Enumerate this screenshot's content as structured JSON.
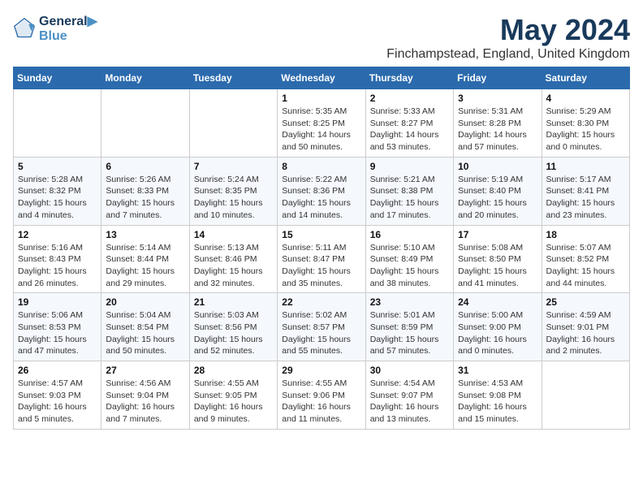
{
  "logo": {
    "line1": "General",
    "line2": "Blue"
  },
  "title": "May 2024",
  "location": "Finchampstead, England, United Kingdom",
  "weekdays": [
    "Sunday",
    "Monday",
    "Tuesday",
    "Wednesday",
    "Thursday",
    "Friday",
    "Saturday"
  ],
  "weeks": [
    [
      {
        "day": "",
        "info": ""
      },
      {
        "day": "",
        "info": ""
      },
      {
        "day": "",
        "info": ""
      },
      {
        "day": "1",
        "info": "Sunrise: 5:35 AM\nSunset: 8:25 PM\nDaylight: 14 hours\nand 50 minutes."
      },
      {
        "day": "2",
        "info": "Sunrise: 5:33 AM\nSunset: 8:27 PM\nDaylight: 14 hours\nand 53 minutes."
      },
      {
        "day": "3",
        "info": "Sunrise: 5:31 AM\nSunset: 8:28 PM\nDaylight: 14 hours\nand 57 minutes."
      },
      {
        "day": "4",
        "info": "Sunrise: 5:29 AM\nSunset: 8:30 PM\nDaylight: 15 hours\nand 0 minutes."
      }
    ],
    [
      {
        "day": "5",
        "info": "Sunrise: 5:28 AM\nSunset: 8:32 PM\nDaylight: 15 hours\nand 4 minutes."
      },
      {
        "day": "6",
        "info": "Sunrise: 5:26 AM\nSunset: 8:33 PM\nDaylight: 15 hours\nand 7 minutes."
      },
      {
        "day": "7",
        "info": "Sunrise: 5:24 AM\nSunset: 8:35 PM\nDaylight: 15 hours\nand 10 minutes."
      },
      {
        "day": "8",
        "info": "Sunrise: 5:22 AM\nSunset: 8:36 PM\nDaylight: 15 hours\nand 14 minutes."
      },
      {
        "day": "9",
        "info": "Sunrise: 5:21 AM\nSunset: 8:38 PM\nDaylight: 15 hours\nand 17 minutes."
      },
      {
        "day": "10",
        "info": "Sunrise: 5:19 AM\nSunset: 8:40 PM\nDaylight: 15 hours\nand 20 minutes."
      },
      {
        "day": "11",
        "info": "Sunrise: 5:17 AM\nSunset: 8:41 PM\nDaylight: 15 hours\nand 23 minutes."
      }
    ],
    [
      {
        "day": "12",
        "info": "Sunrise: 5:16 AM\nSunset: 8:43 PM\nDaylight: 15 hours\nand 26 minutes."
      },
      {
        "day": "13",
        "info": "Sunrise: 5:14 AM\nSunset: 8:44 PM\nDaylight: 15 hours\nand 29 minutes."
      },
      {
        "day": "14",
        "info": "Sunrise: 5:13 AM\nSunset: 8:46 PM\nDaylight: 15 hours\nand 32 minutes."
      },
      {
        "day": "15",
        "info": "Sunrise: 5:11 AM\nSunset: 8:47 PM\nDaylight: 15 hours\nand 35 minutes."
      },
      {
        "day": "16",
        "info": "Sunrise: 5:10 AM\nSunset: 8:49 PM\nDaylight: 15 hours\nand 38 minutes."
      },
      {
        "day": "17",
        "info": "Sunrise: 5:08 AM\nSunset: 8:50 PM\nDaylight: 15 hours\nand 41 minutes."
      },
      {
        "day": "18",
        "info": "Sunrise: 5:07 AM\nSunset: 8:52 PM\nDaylight: 15 hours\nand 44 minutes."
      }
    ],
    [
      {
        "day": "19",
        "info": "Sunrise: 5:06 AM\nSunset: 8:53 PM\nDaylight: 15 hours\nand 47 minutes."
      },
      {
        "day": "20",
        "info": "Sunrise: 5:04 AM\nSunset: 8:54 PM\nDaylight: 15 hours\nand 50 minutes."
      },
      {
        "day": "21",
        "info": "Sunrise: 5:03 AM\nSunset: 8:56 PM\nDaylight: 15 hours\nand 52 minutes."
      },
      {
        "day": "22",
        "info": "Sunrise: 5:02 AM\nSunset: 8:57 PM\nDaylight: 15 hours\nand 55 minutes."
      },
      {
        "day": "23",
        "info": "Sunrise: 5:01 AM\nSunset: 8:59 PM\nDaylight: 15 hours\nand 57 minutes."
      },
      {
        "day": "24",
        "info": "Sunrise: 5:00 AM\nSunset: 9:00 PM\nDaylight: 16 hours\nand 0 minutes."
      },
      {
        "day": "25",
        "info": "Sunrise: 4:59 AM\nSunset: 9:01 PM\nDaylight: 16 hours\nand 2 minutes."
      }
    ],
    [
      {
        "day": "26",
        "info": "Sunrise: 4:57 AM\nSunset: 9:03 PM\nDaylight: 16 hours\nand 5 minutes."
      },
      {
        "day": "27",
        "info": "Sunrise: 4:56 AM\nSunset: 9:04 PM\nDaylight: 16 hours\nand 7 minutes."
      },
      {
        "day": "28",
        "info": "Sunrise: 4:55 AM\nSunset: 9:05 PM\nDaylight: 16 hours\nand 9 minutes."
      },
      {
        "day": "29",
        "info": "Sunrise: 4:55 AM\nSunset: 9:06 PM\nDaylight: 16 hours\nand 11 minutes."
      },
      {
        "day": "30",
        "info": "Sunrise: 4:54 AM\nSunset: 9:07 PM\nDaylight: 16 hours\nand 13 minutes."
      },
      {
        "day": "31",
        "info": "Sunrise: 4:53 AM\nSunset: 9:08 PM\nDaylight: 16 hours\nand 15 minutes."
      },
      {
        "day": "",
        "info": ""
      }
    ]
  ]
}
